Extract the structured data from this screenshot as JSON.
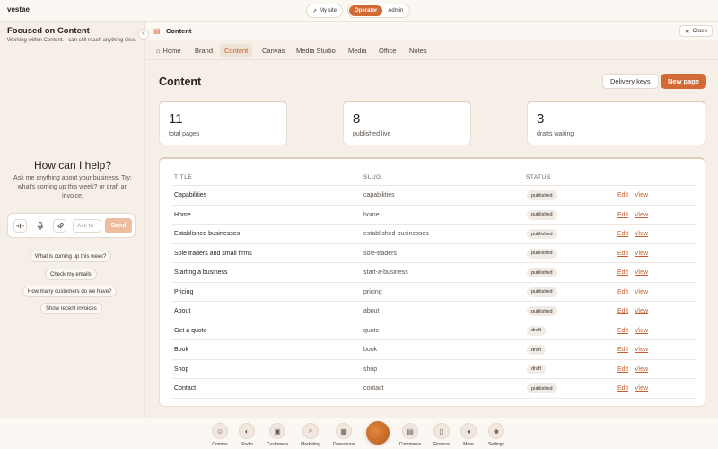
{
  "app": {
    "name": "vestae"
  },
  "topbar": {
    "my_site": "My site",
    "modes": [
      "Operator",
      "Admin"
    ],
    "active_mode": "Operator"
  },
  "sidebar": {
    "title": "Focused on Content",
    "subtitle": "Working within Content. I can still reach anything else.",
    "collapse_icon": "«",
    "help_title": "How can I help?",
    "help_subtitle": "Ask me anything about your business. Try: what's coming up this week? or draft an invoice.",
    "composer": {
      "placeholder": "Ask th",
      "send_label": "Send"
    },
    "suggestions": [
      "What is coming up this week?",
      "Check my emails",
      "How many customers do we have?",
      "Show recent invoices"
    ]
  },
  "main": {
    "crumb": "Content",
    "close_label": "Close",
    "tabs": [
      {
        "label": "Home",
        "active": false
      },
      {
        "label": "Brand",
        "active": false
      },
      {
        "label": "Content",
        "active": true
      },
      {
        "label": "Canvas",
        "active": false
      },
      {
        "label": "Media Studio",
        "active": false
      },
      {
        "label": "Media",
        "active": false
      },
      {
        "label": "Office",
        "active": false
      },
      {
        "label": "Notes",
        "active": false
      }
    ],
    "page_title": "Content",
    "delivery_keys": "Delivery keys",
    "new_page": "New page",
    "stats": [
      {
        "value": "11",
        "label": "total pages"
      },
      {
        "value": "8",
        "label": "published live"
      },
      {
        "value": "3",
        "label": "drafts waiting"
      }
    ],
    "table": {
      "headers": [
        "TITLE",
        "SLUG",
        "STATUS"
      ],
      "edit_label": "Edit",
      "view_label": "View",
      "rows": [
        {
          "title": "Capabilities",
          "slug": "capabilities",
          "status": "published"
        },
        {
          "title": "Home",
          "slug": "home",
          "status": "published"
        },
        {
          "title": "Established businesses",
          "slug": "established-businesses",
          "status": "published"
        },
        {
          "title": "Sole traders and small firms",
          "slug": "sole-traders",
          "status": "published"
        },
        {
          "title": "Starting a business",
          "slug": "start-a-business",
          "status": "published"
        },
        {
          "title": "Pricing",
          "slug": "pricing",
          "status": "published"
        },
        {
          "title": "About",
          "slug": "about",
          "status": "published"
        },
        {
          "title": "Get a quote",
          "slug": "quote",
          "status": "draft"
        },
        {
          "title": "Book",
          "slug": "book",
          "status": "draft"
        },
        {
          "title": "Shop",
          "slug": "shop",
          "status": "draft"
        },
        {
          "title": "Contact",
          "slug": "contact",
          "status": "published"
        }
      ]
    }
  },
  "dock": {
    "items": [
      {
        "label": "Comms",
        "icon": "people-icon"
      },
      {
        "label": "Studio",
        "icon": "palette-icon"
      },
      {
        "label": "Customers",
        "icon": "contacts-icon"
      },
      {
        "label": "Marketing",
        "icon": "search-icon"
      },
      {
        "label": "Operations",
        "icon": "calendar-icon"
      },
      {
        "label": "Commerce",
        "icon": "wallet-icon"
      },
      {
        "label": "Finance",
        "icon": "document-icon"
      },
      {
        "label": "More",
        "icon": "megaphone-icon"
      },
      {
        "label": "Settings",
        "icon": "team-icon"
      }
    ]
  }
}
